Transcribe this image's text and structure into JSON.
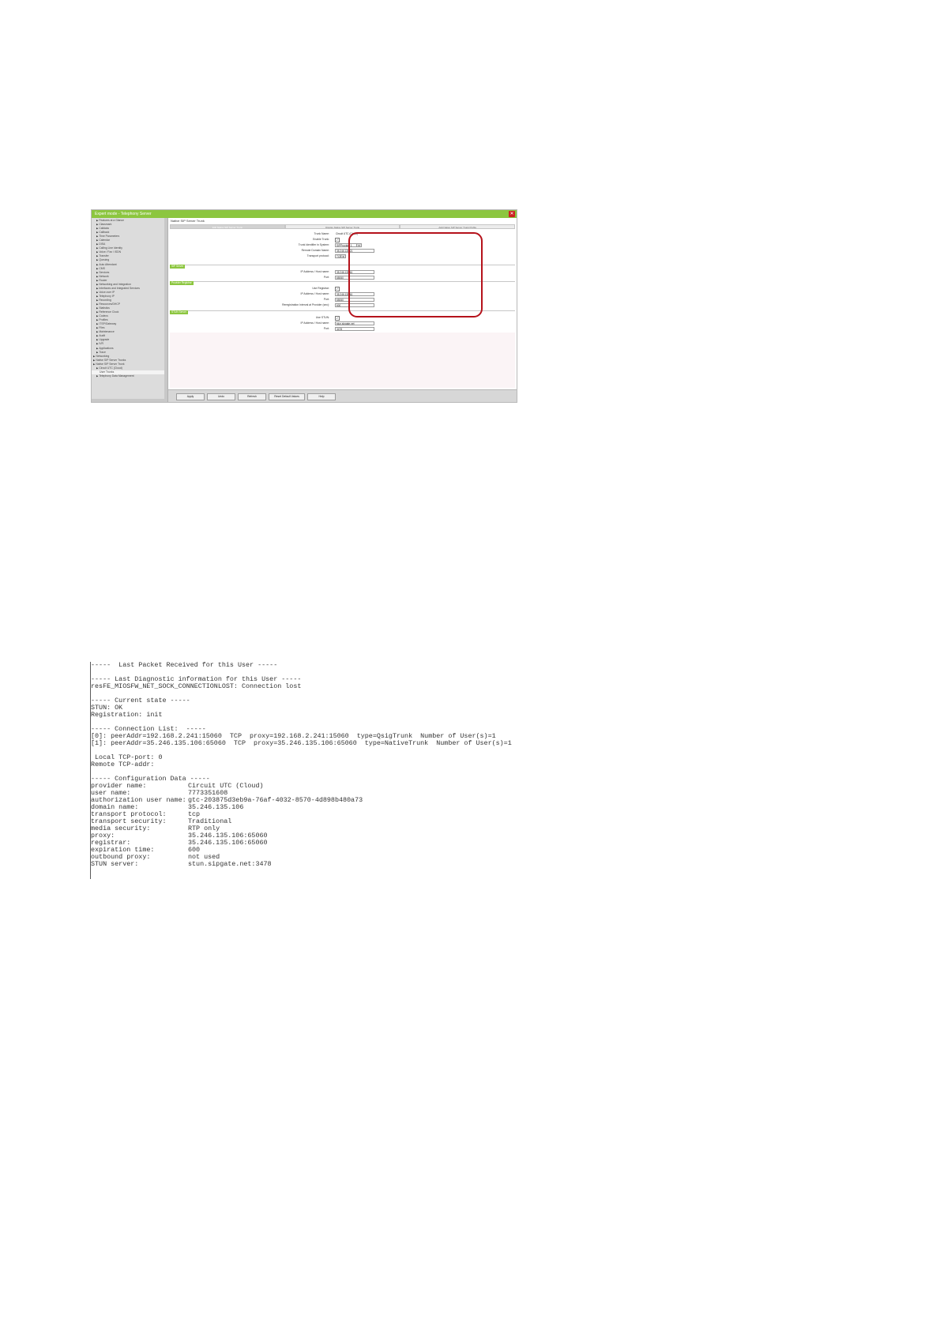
{
  "ui_screenshot": {
    "window_title": "Expert mode - Telephony Server",
    "page_title": "Native SIP Server Trunk",
    "tabs": [
      "Edit Native SIP Server Trunk",
      "Display Native SIP Server Trunk",
      "Add Native SIP Server Trunk Profile"
    ],
    "sidebar_items": [
      {
        "label": "Features at a Glance",
        "level": 1
      },
      {
        "label": "Classmark",
        "level": 1
      },
      {
        "label": "Calldata",
        "level": 1
      },
      {
        "label": "Callback",
        "level": 1
      },
      {
        "label": "Time Parameters",
        "level": 1
      },
      {
        "label": "Calendar",
        "level": 1
      },
      {
        "label": "DISA",
        "level": 1
      },
      {
        "label": "Calling Line Identity",
        "level": 1
      },
      {
        "label": "Voice / Fax / ISDN",
        "level": 1
      },
      {
        "label": "Transfer",
        "level": 1
      },
      {
        "label": "Queuing",
        "level": 1
      },
      {
        "label": "Auto Attendant",
        "level": 1
      },
      {
        "label": "CMS",
        "level": 1
      },
      {
        "label": "Services",
        "level": 1
      },
      {
        "label": "Network",
        "level": 1
      },
      {
        "label": "Router",
        "level": 1
      },
      {
        "label": "Networking and Integration",
        "level": 1
      },
      {
        "label": "Interfaces and Integrated Services",
        "level": 1
      },
      {
        "label": "Voice over IP",
        "level": 1
      },
      {
        "label": "Telephony IP",
        "level": 1
      },
      {
        "label": "Recording",
        "level": 1
      },
      {
        "label": "Resources/DHCP",
        "level": 1
      },
      {
        "label": "Statistics",
        "level": 1
      },
      {
        "label": "Reference Clock",
        "level": 1
      },
      {
        "label": "Codecs",
        "level": 1
      },
      {
        "label": "Profiles",
        "level": 1
      },
      {
        "label": "ITSP/Gateway",
        "level": 1
      },
      {
        "label": "Files",
        "level": 1
      },
      {
        "label": "Maintenance",
        "level": 1
      },
      {
        "label": "Audit",
        "level": 1
      },
      {
        "label": "Upgrade",
        "level": 1
      },
      {
        "label": "IVR",
        "level": 1
      },
      {
        "label": "Applications",
        "level": 1
      },
      {
        "label": "Trace",
        "level": 1
      },
      {
        "label": "Networking",
        "level": 0
      },
      {
        "label": "Native SIP Server Trunks",
        "level": 0
      },
      {
        "label": "Native SIP Server Trunk",
        "level": 0
      },
      {
        "label": "Circuit UTC (Cloud)",
        "level": 1
      },
      {
        "label": "User Trunks",
        "level": 2
      },
      {
        "label": "Telephony Data Management",
        "level": 1
      }
    ],
    "form": {
      "trunk_name_label": "Trunk Name:",
      "trunk_name_value": "Circuit UTC (Cloud)",
      "enable_trunk_label": "Enable Trunk:",
      "trunk_identifier_label": "Trunk Identifier in System:",
      "trunk_identifier_value": "SIPProvider 1",
      "remote_domain_label": "Remote Domain Name:",
      "remote_domain_value": "35.246.135.21",
      "transport_label": "Transport protocol:",
      "transport_value": "TCP",
      "sip_server_section": "SIP Server",
      "sip_ip_label": "IP Address / Host name:",
      "sip_ip_value": "35.246.135.61",
      "sip_port_label": "Port:",
      "sip_port_value": "65060",
      "registrar_section": "Provider Registrar",
      "use_registrar_label": "Use Registrar:",
      "reg_ip_label": "IP Address / Host name:",
      "reg_ip_value": "35.246.135.61",
      "reg_port_label": "Port:",
      "reg_port_value": "65060",
      "reg_interval_label": "Reregistration Interval at Provider (sec):",
      "reg_interval_value": "600",
      "stun_section": "STUN Server",
      "use_stun_label": "Use STUN:",
      "stun_ip_label": "IP Address / Host name:",
      "stun_ip_value": "stun.sipgate.net",
      "stun_port_label": "Port:",
      "stun_port_value": "3478"
    },
    "buttons": [
      "Apply",
      "Undo",
      "Refresh",
      "Reset Default Values",
      "Help"
    ]
  },
  "diagnostic_log": {
    "lines": [
      "-----  Last Packet Received for this User -----",
      "",
      "----- Last Diagnostic information for this User -----",
      "resFE_MIOSFW_NET_SOCK_CONNECTIONLOST: Connection lost",
      "",
      "----- Current state -----",
      "STUN: OK",
      "Registration: init",
      "",
      "----- Connection List:  -----",
      "[0]: peerAddr=192.168.2.241:15060  TCP  proxy=192.168.2.241:15060  type=QsigTrunk  Number of User(s)=1",
      "[1]: peerAddr=35.246.135.106:65060  TCP  proxy=35.246.135.106:65060  type=NativeTrunk  Number of User(s)=1",
      "",
      " Local TCP-port: 0",
      "Remote TCP-addr:",
      "",
      "----- Configuration Data -----"
    ],
    "config": [
      {
        "key": "provider name:",
        "value": "Circuit UTC (Cloud)"
      },
      {
        "key": "user name:",
        "value": "7773351608"
      },
      {
        "key": "authorization user name:",
        "value": "gtc-203875d3eb9a-76af-4032-8570-4d898b480a73"
      },
      {
        "key": "domain name:",
        "value": "35.246.135.106"
      },
      {
        "key": "transport protocol:",
        "value": "tcp"
      },
      {
        "key": "transport security:",
        "value": "Traditional"
      },
      {
        "key": "media security:",
        "value": "RTP only"
      },
      {
        "key": "proxy:",
        "value": "35.246.135.106:65060"
      },
      {
        "key": "registrar:",
        "value": "35.246.135.106:65060"
      },
      {
        "key": "expiration time:",
        "value": "600"
      },
      {
        "key": "outbound proxy:",
        "value": "not used"
      },
      {
        "key": "STUN server:",
        "value": "stun.sipgate.net:3478"
      }
    ]
  },
  "colors": {
    "accent_green": "#8cc63f",
    "highlight_red": "#b5121b",
    "close_red": "#cc2222"
  }
}
